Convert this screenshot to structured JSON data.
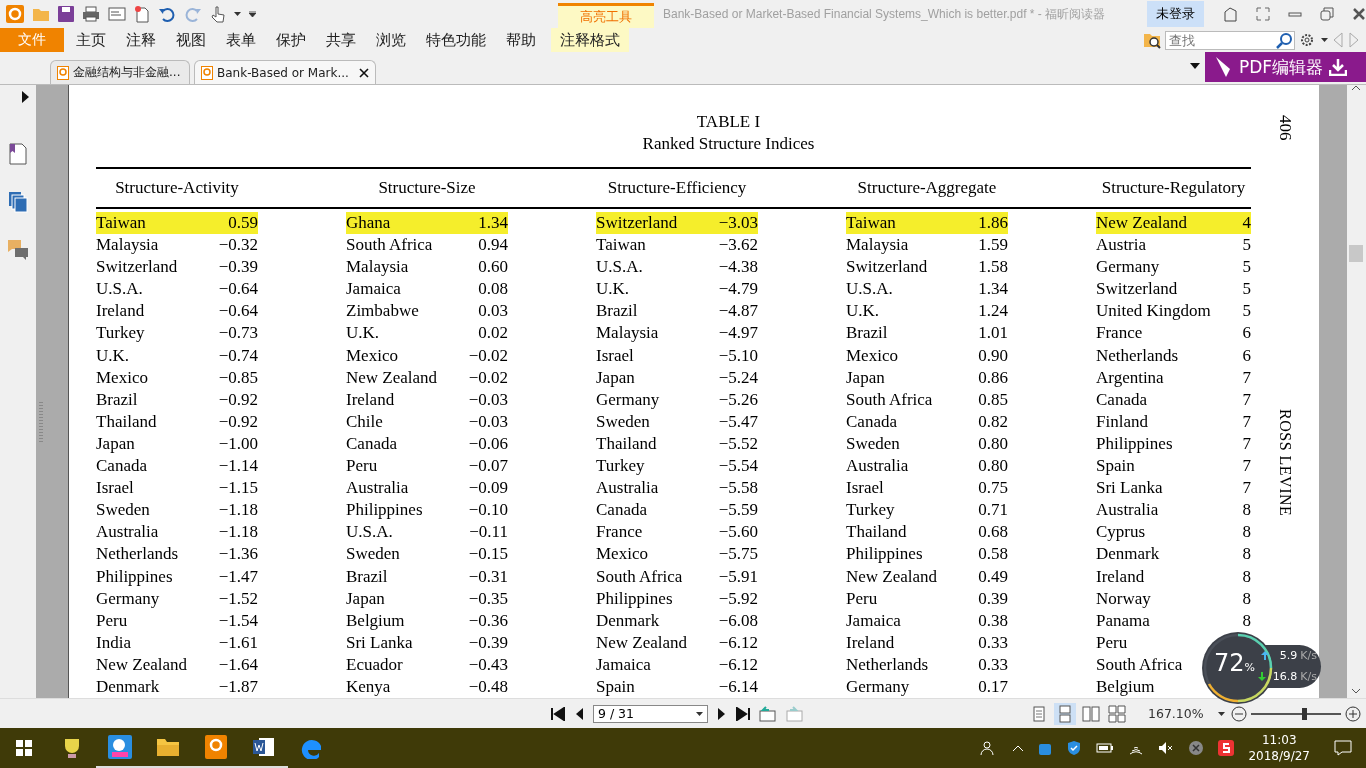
{
  "title_bar": {
    "context_tab": "高亮工具",
    "title": "Bank-Based or Market-Based Financial Systems_Which is better.pdf * - 福昕阅读器",
    "login": "未登录"
  },
  "ribbon": {
    "file": "文件",
    "items": [
      "主页",
      "注释",
      "视图",
      "表单",
      "保护",
      "共享",
      "浏览",
      "特色功能",
      "帮助"
    ],
    "context_item": "注释格式"
  },
  "search": {
    "placeholder": "查找"
  },
  "promo": "PDF编辑器",
  "doc_tabs": [
    {
      "label": "金融结构与非金融...",
      "selected": false
    },
    {
      "label": "Bank-Based or Mark...",
      "selected": true
    }
  ],
  "page": {
    "title": "TABLE I",
    "subtitle": "Ranked Structure Indices",
    "page_number": "406",
    "running_head": "ROSS LEVINE",
    "columns": [
      {
        "header": "Structure-Activity",
        "rows": [
          {
            "name": "Taiwan",
            "value": "0.59",
            "highlighted": true
          },
          {
            "name": "Malaysia",
            "value": "−0.32",
            "highlighted": false
          },
          {
            "name": "Switzerland",
            "value": "−0.39",
            "highlighted": false
          },
          {
            "name": "U.S.A.",
            "value": "−0.64",
            "highlighted": false
          },
          {
            "name": "Ireland",
            "value": "−0.64",
            "highlighted": false
          },
          {
            "name": "Turkey",
            "value": "−0.73",
            "highlighted": false
          },
          {
            "name": "U.K.",
            "value": "−0.74",
            "highlighted": false
          },
          {
            "name": "Mexico",
            "value": "−0.85",
            "highlighted": false
          },
          {
            "name": "Brazil",
            "value": "−0.92",
            "highlighted": false
          },
          {
            "name": "Thailand",
            "value": "−0.92",
            "highlighted": false
          },
          {
            "name": "Japan",
            "value": "−1.00",
            "highlighted": false
          },
          {
            "name": "Canada",
            "value": "−1.14",
            "highlighted": false
          },
          {
            "name": "Israel",
            "value": "−1.15",
            "highlighted": false
          },
          {
            "name": "Sweden",
            "value": "−1.18",
            "highlighted": false
          },
          {
            "name": "Australia",
            "value": "−1.18",
            "highlighted": false
          },
          {
            "name": "Netherlands",
            "value": "−1.36",
            "highlighted": false
          },
          {
            "name": "Philippines",
            "value": "−1.47",
            "highlighted": false
          },
          {
            "name": "Germany",
            "value": "−1.52",
            "highlighted": false
          },
          {
            "name": "Peru",
            "value": "−1.54",
            "highlighted": false
          },
          {
            "name": "India",
            "value": "−1.61",
            "highlighted": false
          },
          {
            "name": "New Zealand",
            "value": "−1.64",
            "highlighted": false
          },
          {
            "name": "Denmark",
            "value": "−1.87",
            "highlighted": false
          }
        ]
      },
      {
        "header": "Structure-Size",
        "rows": [
          {
            "name": "Ghana",
            "value": "1.34",
            "highlighted": true
          },
          {
            "name": "South Africa",
            "value": "0.94",
            "highlighted": false
          },
          {
            "name": "Malaysia",
            "value": "0.60",
            "highlighted": false
          },
          {
            "name": "Jamaica",
            "value": "0.08",
            "highlighted": false
          },
          {
            "name": "Zimbabwe",
            "value": "0.03",
            "highlighted": false
          },
          {
            "name": "U.K.",
            "value": "0.02",
            "highlighted": false
          },
          {
            "name": "Mexico",
            "value": "−0.02",
            "highlighted": false
          },
          {
            "name": "New Zealand",
            "value": "−0.02",
            "highlighted": false
          },
          {
            "name": "Ireland",
            "value": "−0.03",
            "highlighted": false
          },
          {
            "name": "Chile",
            "value": "−0.03",
            "highlighted": false
          },
          {
            "name": "Canada",
            "value": "−0.06",
            "highlighted": false
          },
          {
            "name": "Peru",
            "value": "−0.07",
            "highlighted": false
          },
          {
            "name": "Australia",
            "value": "−0.09",
            "highlighted": false
          },
          {
            "name": "Philippines",
            "value": "−0.10",
            "highlighted": false
          },
          {
            "name": "U.S.A.",
            "value": "−0.11",
            "highlighted": false
          },
          {
            "name": "Sweden",
            "value": "−0.15",
            "highlighted": false
          },
          {
            "name": "Brazil",
            "value": "−0.31",
            "highlighted": false
          },
          {
            "name": "Japan",
            "value": "−0.35",
            "highlighted": false
          },
          {
            "name": "Belgium",
            "value": "−0.36",
            "highlighted": false
          },
          {
            "name": "Sri Lanka",
            "value": "−0.39",
            "highlighted": false
          },
          {
            "name": "Ecuador",
            "value": "−0.43",
            "highlighted": false
          },
          {
            "name": "Kenya",
            "value": "−0.48",
            "highlighted": false
          }
        ]
      },
      {
        "header": "Structure-Efficiency",
        "rows": [
          {
            "name": "Switzerland",
            "value": "−3.03",
            "highlighted": true
          },
          {
            "name": "Taiwan",
            "value": "−3.62",
            "highlighted": false
          },
          {
            "name": "U.S.A.",
            "value": "−4.38",
            "highlighted": false
          },
          {
            "name": "U.K.",
            "value": "−4.79",
            "highlighted": false
          },
          {
            "name": "Brazil",
            "value": "−4.87",
            "highlighted": false
          },
          {
            "name": "Malaysia",
            "value": "−4.97",
            "highlighted": false
          },
          {
            "name": "Israel",
            "value": "−5.10",
            "highlighted": false
          },
          {
            "name": "Japan",
            "value": "−5.24",
            "highlighted": false
          },
          {
            "name": "Germany",
            "value": "−5.26",
            "highlighted": false
          },
          {
            "name": "Sweden",
            "value": "−5.47",
            "highlighted": false
          },
          {
            "name": "Thailand",
            "value": "−5.52",
            "highlighted": false
          },
          {
            "name": "Turkey",
            "value": "−5.54",
            "highlighted": false
          },
          {
            "name": "Australia",
            "value": "−5.58",
            "highlighted": false
          },
          {
            "name": "Canada",
            "value": "−5.59",
            "highlighted": false
          },
          {
            "name": "France",
            "value": "−5.60",
            "highlighted": false
          },
          {
            "name": "Mexico",
            "value": "−5.75",
            "highlighted": false
          },
          {
            "name": "South Africa",
            "value": "−5.91",
            "highlighted": false
          },
          {
            "name": "Philippines",
            "value": "−5.92",
            "highlighted": false
          },
          {
            "name": "Denmark",
            "value": "−6.08",
            "highlighted": false
          },
          {
            "name": "New Zealand",
            "value": "−6.12",
            "highlighted": false
          },
          {
            "name": "Jamaica",
            "value": "−6.12",
            "highlighted": false
          },
          {
            "name": "Spain",
            "value": "−6.14",
            "highlighted": false
          }
        ]
      },
      {
        "header": "Structure-Aggregate",
        "rows": [
          {
            "name": "Taiwan",
            "value": "1.86",
            "highlighted": true
          },
          {
            "name": "Malaysia",
            "value": "1.59",
            "highlighted": false
          },
          {
            "name": "Switzerland",
            "value": "1.58",
            "highlighted": false
          },
          {
            "name": "U.S.A.",
            "value": "1.34",
            "highlighted": false
          },
          {
            "name": "U.K.",
            "value": "1.24",
            "highlighted": false
          },
          {
            "name": "Brazil",
            "value": "1.01",
            "highlighted": false
          },
          {
            "name": "Mexico",
            "value": "0.90",
            "highlighted": false
          },
          {
            "name": "Japan",
            "value": "0.86",
            "highlighted": false
          },
          {
            "name": "South Africa",
            "value": "0.85",
            "highlighted": false
          },
          {
            "name": "Canada",
            "value": "0.82",
            "highlighted": false
          },
          {
            "name": "Sweden",
            "value": "0.80",
            "highlighted": false
          },
          {
            "name": "Australia",
            "value": "0.80",
            "highlighted": false
          },
          {
            "name": "Israel",
            "value": "0.75",
            "highlighted": false
          },
          {
            "name": "Turkey",
            "value": "0.71",
            "highlighted": false
          },
          {
            "name": "Thailand",
            "value": "0.68",
            "highlighted": false
          },
          {
            "name": "Philippines",
            "value": "0.58",
            "highlighted": false
          },
          {
            "name": "New Zealand",
            "value": "0.49",
            "highlighted": false
          },
          {
            "name": "Peru",
            "value": "0.39",
            "highlighted": false
          },
          {
            "name": "Jamaica",
            "value": "0.38",
            "highlighted": false
          },
          {
            "name": "Ireland",
            "value": "0.33",
            "highlighted": false
          },
          {
            "name": "Netherlands",
            "value": "0.33",
            "highlighted": false
          },
          {
            "name": "Germany",
            "value": "0.17",
            "highlighted": false
          }
        ]
      },
      {
        "header": "Structure-Regulatory",
        "rows": [
          {
            "name": "New Zealand",
            "value": "4",
            "highlighted": true
          },
          {
            "name": "Austria",
            "value": "5",
            "highlighted": false
          },
          {
            "name": "Germany",
            "value": "5",
            "highlighted": false
          },
          {
            "name": "Switzerland",
            "value": "5",
            "highlighted": false
          },
          {
            "name": "United Kingdom",
            "value": "5",
            "highlighted": false
          },
          {
            "name": "France",
            "value": "6",
            "highlighted": false
          },
          {
            "name": "Netherlands",
            "value": "6",
            "highlighted": false
          },
          {
            "name": "Argentina",
            "value": "7",
            "highlighted": false
          },
          {
            "name": "Canada",
            "value": "7",
            "highlighted": false
          },
          {
            "name": "Finland",
            "value": "7",
            "highlighted": false
          },
          {
            "name": "Philippines",
            "value": "7",
            "highlighted": false
          },
          {
            "name": "Spain",
            "value": "7",
            "highlighted": false
          },
          {
            "name": "Sri Lanka",
            "value": "7",
            "highlighted": false
          },
          {
            "name": "Australia",
            "value": "8",
            "highlighted": false
          },
          {
            "name": "Cyprus",
            "value": "8",
            "highlighted": false
          },
          {
            "name": "Denmark",
            "value": "8",
            "highlighted": false
          },
          {
            "name": "Ireland",
            "value": "8",
            "highlighted": false
          },
          {
            "name": "Norway",
            "value": "8",
            "highlighted": false
          },
          {
            "name": "Panama",
            "value": "8",
            "highlighted": false
          },
          {
            "name": "Peru",
            "highlighted": false
          },
          {
            "name": "South Africa",
            "highlighted": false
          },
          {
            "name": "Belgium",
            "highlighted": false
          }
        ]
      }
    ]
  },
  "status_bar": {
    "page_field": "9 / 31",
    "view_modes": [
      {
        "kind": "single",
        "selected": false
      },
      {
        "kind": "continuous",
        "selected": true
      },
      {
        "kind": "facing",
        "selected": false
      },
      {
        "kind": "cover",
        "selected": false
      }
    ],
    "zoom": "167.10%",
    "zoom_slider": {
      "level": 0.59
    }
  },
  "network_widget": {
    "percent": "72",
    "percent_sign": "%",
    "upload": "5.9",
    "upload_unit": "K/s",
    "download": "16.8",
    "download_unit": "K/s"
  },
  "taskbar": {
    "time": "11:03",
    "date": "2018/9/27"
  }
}
